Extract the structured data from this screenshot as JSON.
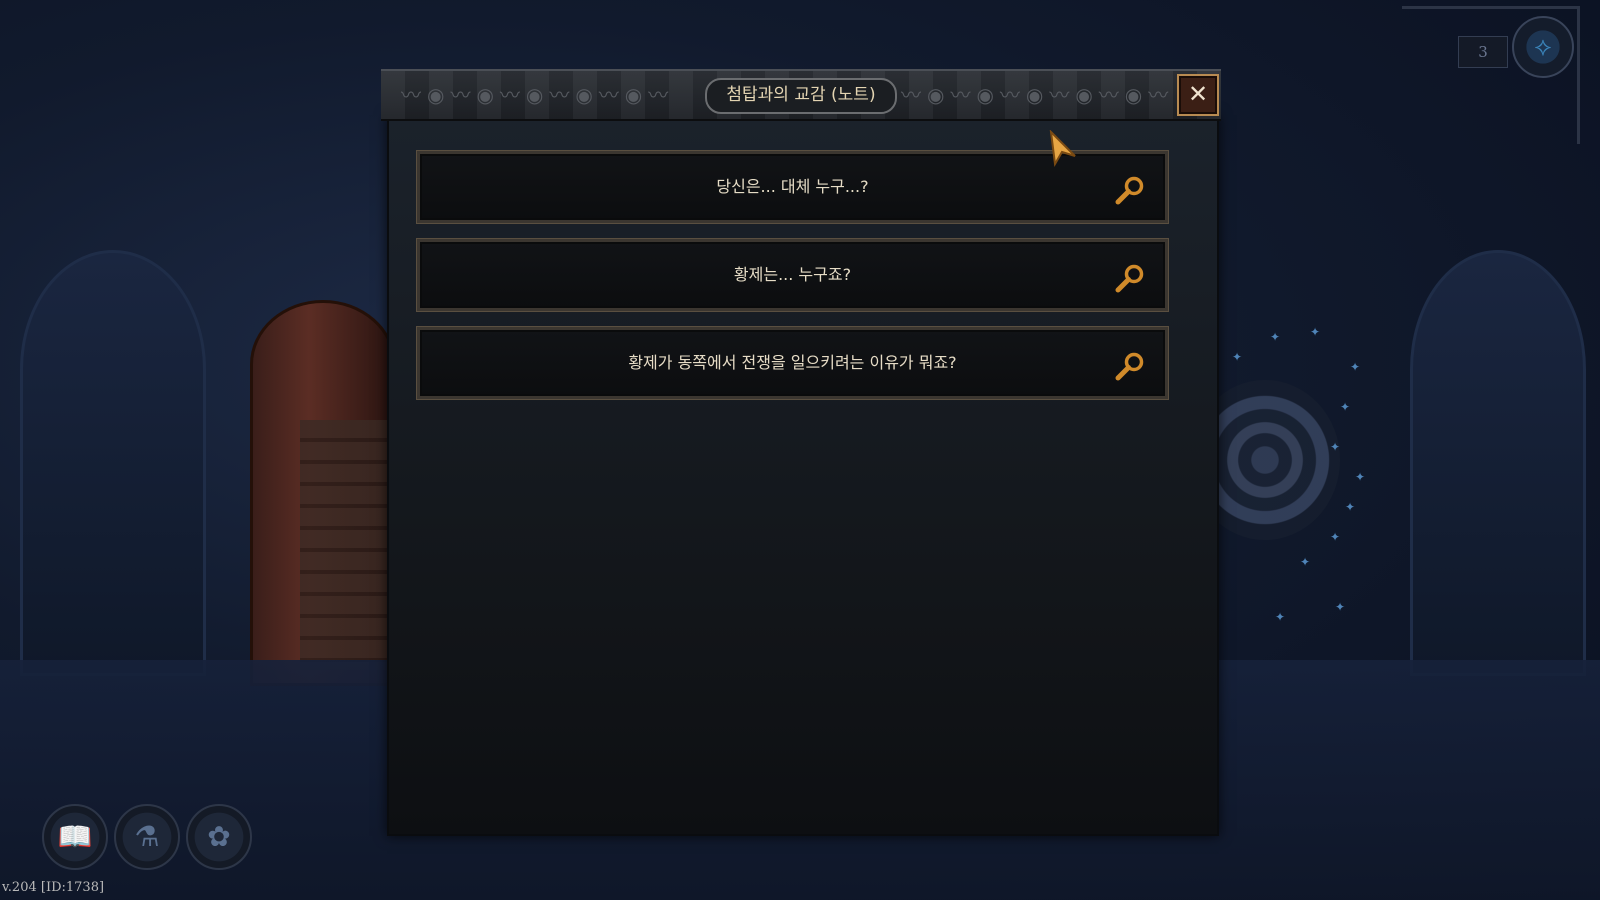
{
  "dialog": {
    "title": "첨탑과의 교감 (노트)",
    "close_label": "✕",
    "questions": [
      {
        "label": "당신은... 대체 누구...?"
      },
      {
        "label": "황제는... 누구죠?"
      },
      {
        "label": "황제가 동쪽에서 전쟁을 일으키려는 이유가 뭐죠?"
      }
    ]
  },
  "hud": {
    "counter": "3",
    "emblem_icon": "spire-emblem-icon"
  },
  "toolbar": {
    "icons": [
      "journal-book-icon",
      "potion-icon",
      "rune-icon"
    ]
  },
  "footer": {
    "version": "v.204 [ID:1738]"
  },
  "colors": {
    "accent_gold": "#d08a2a",
    "text_parchment": "#e6dcc6",
    "close_border": "#b88b52"
  }
}
